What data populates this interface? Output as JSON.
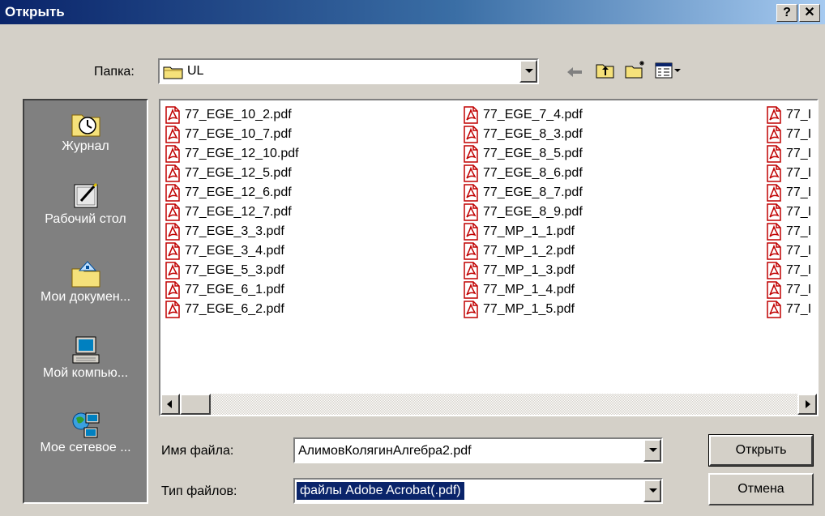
{
  "window": {
    "title": "Открыть",
    "help_label": "?",
    "close_label": "✕"
  },
  "lookin": {
    "label": "Папка:",
    "value": "UL"
  },
  "places": [
    {
      "label": "Журнал",
      "icon": "history-icon"
    },
    {
      "label": "Рабочий стол",
      "icon": "desktop-icon"
    },
    {
      "label": "Мои докумен...",
      "icon": "my-documents-icon"
    },
    {
      "label": "Мой компью...",
      "icon": "my-computer-icon"
    },
    {
      "label": "Мое сетевое ...",
      "icon": "network-icon"
    }
  ],
  "files": {
    "col1": [
      "77_EGE_10_2.pdf",
      "77_EGE_10_7.pdf",
      "77_EGE_12_10.pdf",
      "77_EGE_12_5.pdf",
      "77_EGE_12_6.pdf",
      "77_EGE_12_7.pdf",
      "77_EGE_3_3.pdf",
      "77_EGE_3_4.pdf",
      "77_EGE_5_3.pdf",
      "77_EGE_6_1.pdf",
      "77_EGE_6_2.pdf"
    ],
    "col2": [
      "77_EGE_7_4.pdf",
      "77_EGE_8_3.pdf",
      "77_EGE_8_5.pdf",
      "77_EGE_8_6.pdf",
      "77_EGE_8_7.pdf",
      "77_EGE_8_9.pdf",
      "77_MP_1_1.pdf",
      "77_MP_1_2.pdf",
      "77_MP_1_3.pdf",
      "77_MP_1_4.pdf",
      "77_MP_1_5.pdf"
    ],
    "col3": [
      "77_I",
      "77_I",
      "77_I",
      "77_I",
      "77_I",
      "77_I",
      "77_I",
      "77_I",
      "77_I",
      "77_I",
      "77_I"
    ]
  },
  "filename": {
    "label": "Имя файла:",
    "value": "АлимовКолягинАлгебра2.pdf"
  },
  "filetype": {
    "label": "Тип файлов:",
    "value": "файлы Adobe Acrobat(.pdf)"
  },
  "buttons": {
    "open": "Открыть",
    "cancel": "Отмена"
  },
  "colors": {
    "title_start": "#0a246a",
    "title_end": "#a6caf0",
    "face": "#d4d0c8",
    "selection": "#0a246a"
  }
}
